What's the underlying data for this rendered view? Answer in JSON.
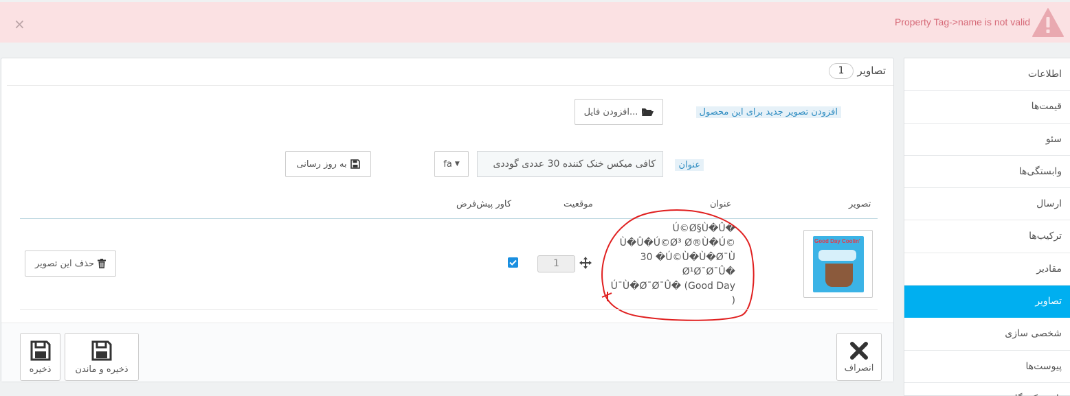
{
  "alert": {
    "message": "Property Tag->name is not valid",
    "close_glyph": "×",
    "icon": "warning-triangle-icon",
    "color": "#fbe1e3"
  },
  "sidebar": {
    "items": [
      {
        "label": "اطلاعات"
      },
      {
        "label": "قیمت‌ها"
      },
      {
        "label": "سئو"
      },
      {
        "label": "وابستگی‌ها"
      },
      {
        "label": "ارسال"
      },
      {
        "label": "ترکیب‌ها"
      },
      {
        "label": "مقادیر"
      },
      {
        "label": "تصاویر",
        "active": true
      },
      {
        "label": "شخصی سازی"
      },
      {
        "label": "پیوست‌ها"
      },
      {
        "label": "تامین کنندگان"
      }
    ],
    "active_color": "#00aff0"
  },
  "panel": {
    "title": "تصاویر",
    "count": "1",
    "add_image_label": "افزودن تصویر جدید برای این محصول",
    "add_file_button": "افزودن فایل...",
    "caption_label": "عنوان",
    "caption_value": "کافی میکس خنک کننده 30 عددی گوددی",
    "language": "fa",
    "update_button": "به روز رسانی"
  },
  "table": {
    "headers": {
      "image": "تصویر",
      "caption": "عنوان",
      "position": "موقعیت",
      "cover": "کاور پیش‌فرض"
    },
    "rows": [
      {
        "caption_lines": [
          "Ú©Ø§Ù�Û�",
          "Ù�Û�Ú©Ø³ Ø®Ù�Ú©",
          "30 �Ú©Ù�Ù�Ø¯Ù",
          "Ø¹Ø¯Ø¯Û�",
          "Ú¯Ù�Ø¯Ø¯Û� (Good Day",
          ")"
        ],
        "position": "1",
        "cover": true,
        "delete_button": "حذف این تصویر",
        "thumbnail_text": "Good Day Coolin'"
      }
    ]
  },
  "footer": {
    "cancel": "انصراف",
    "save_stay": "ذخیره و ماندن",
    "save": "ذخیره"
  }
}
